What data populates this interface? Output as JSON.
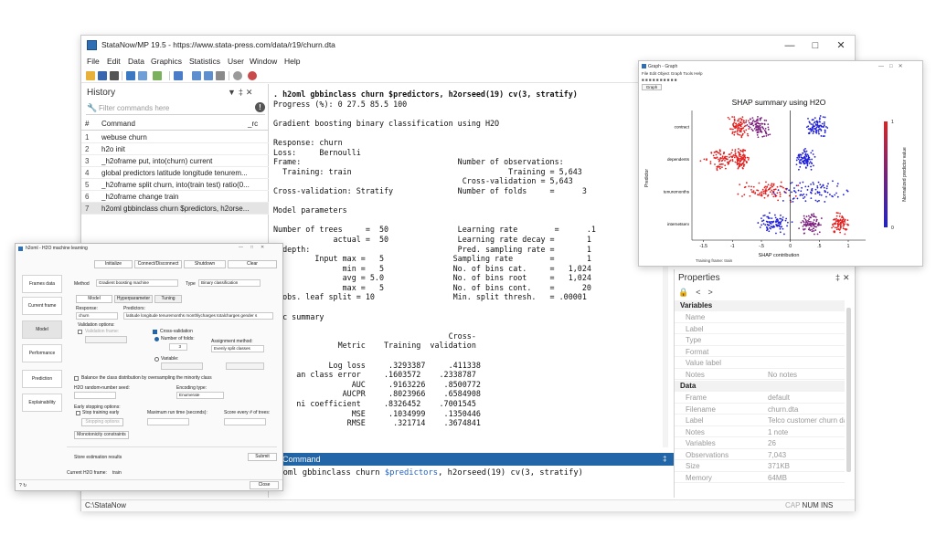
{
  "main": {
    "title": "StataNow/MP 19.5 - https://www.stata-press.com/data/r19/churn.dta",
    "menu": [
      "File",
      "Edit",
      "Data",
      "Graphics",
      "Statistics",
      "User",
      "Window",
      "Help"
    ]
  },
  "history": {
    "title": "History",
    "filter_placeholder": "Filter commands here",
    "col_num": "#",
    "col_command": "Command",
    "col_rc": "_rc",
    "rows": [
      {
        "n": "1",
        "cmd": "webuse churn"
      },
      {
        "n": "2",
        "cmd": "h2o init"
      },
      {
        "n": "3",
        "cmd": "_h2oframe put, into(churn) current"
      },
      {
        "n": "4",
        "cmd": "global predictors latitude longitude tenurem..."
      },
      {
        "n": "5",
        "cmd": "_h2oframe split churn, into(train test) ratio(0..."
      },
      {
        "n": "6",
        "cmd": "_h2oframe change train"
      },
      {
        "n": "7",
        "cmd": "h2oml gbbinclass churn $predictors, h2orse..."
      }
    ]
  },
  "results": {
    "command_line": ". h2oml gbbinclass churn $predictors, h2orseed(19) cv(3, stratify)",
    "body": "\nProgress (%): 0 27.5 85.5 100\n\nGradient boosting binary classification using H2O\n\nResponse: churn\nLoss:     Bernoulli\nFrame:                                  Number of observations:\n  Training: train                                  Training = 5,643\n                                         Cross-validation = 5,643\nCross-validation: Stratify              Number of folds     =      3\n\nModel parameters\n\nNumber of trees     =  50               Learning rate        =      .1\n             actual =  50               Learning rate decay =       1\ne depth:                                Pred. sampling rate =       1\n         Input max =   5               Sampling rate        =       1\n               min =   5               No. of bins cat.     =   1,024\n               avg = 5.0               No. of bins root     =   1,024\n               max =   5               No. of bins cont.    =      20\n. obs. leaf split = 10                 Min. split thresh.   = .00001\n\nric summary\n\n                                      Cross-\n              Metric    Training  validation\n\n            Log loss     .3293387     .411338\n     an class error     .1603572    .2338787\n                 AUC     .9163226    .8500772\n               AUCPR     .8023966    .6584908\n     ni coefficient     .8326452    .7001545\n                 MSE     .1034999    .1350446\n                RMSE      .321714    .3674841"
  },
  "command": {
    "label": "Command",
    "input_prefix": "h2oml gbbinclass churn ",
    "input_global": "$predictors",
    "input_suffix": ", h2orseed(19) cv(3, stratify)"
  },
  "status": {
    "path": "C:\\StataNow",
    "cap": "CAP",
    "num": "NUM",
    "ins": "INS"
  },
  "properties": {
    "title": "Properties",
    "variables_header": "Variables",
    "variables": [
      {
        "k": "Name",
        "v": ""
      },
      {
        "k": "Label",
        "v": ""
      },
      {
        "k": "Type",
        "v": ""
      },
      {
        "k": "Format",
        "v": ""
      },
      {
        "k": "Value label",
        "v": ""
      },
      {
        "k": "Notes",
        "v": "No notes"
      }
    ],
    "data_header": "Data",
    "data": [
      {
        "k": "Frame",
        "v": "default"
      },
      {
        "k": "Filename",
        "v": "churn.dta"
      },
      {
        "k": "Label",
        "v": "Telco customer churn dat"
      },
      {
        "k": "Notes",
        "v": "1 note"
      },
      {
        "k": "Variables",
        "v": "26"
      },
      {
        "k": "Observations",
        "v": "7,043"
      },
      {
        "k": "Size",
        "v": "371KB"
      },
      {
        "k": "Memory",
        "v": "64MB"
      }
    ]
  },
  "graph": {
    "window_title": "Graph - Graph",
    "menu": "File  Edit  Object  Graph  Tools  Help",
    "tab": "Graph",
    "chart_data": {
      "type": "scatter",
      "title": "SHAP summary using H2O",
      "xlabel": "SHAP contribution",
      "ylabel": "Predictor",
      "colorbar_label": "Normalized predictor value",
      "colorbar_ticks": [
        "1",
        "0"
      ],
      "categories": [
        "contract",
        "dependents",
        "tenuremonths",
        "internetserv"
      ],
      "x_ticks": [
        "-1.5",
        "-1",
        "-.5",
        "0",
        ".5",
        "1"
      ],
      "xlim": [
        -1.7,
        1.3
      ],
      "note": "Training frame: train",
      "clusters": [
        {
          "predictor": "contract",
          "x_center": -0.9,
          "spread": 0.1,
          "color": "#e32020"
        },
        {
          "predictor": "contract",
          "x_center": -0.55,
          "spread": 0.12,
          "color": "#7a1f7d"
        },
        {
          "predictor": "contract",
          "x_center": 0.45,
          "spread": 0.12,
          "color": "#2020d8"
        },
        {
          "predictor": "dependents",
          "x_center": -1.2,
          "spread": 0.2,
          "color": "#e32020"
        },
        {
          "predictor": "dependents",
          "x_center": -0.85,
          "spread": 0.1,
          "color": "#e32020"
        },
        {
          "predictor": "dependents",
          "x_center": 0.25,
          "spread": 0.1,
          "color": "#2020d8"
        },
        {
          "predictor": "tenuremonths",
          "x_center": -0.4,
          "spread": 0.28,
          "color": "#e32020"
        },
        {
          "predictor": "tenuremonths",
          "x_center": 0.35,
          "spread": 0.4,
          "color": "#2020d8"
        },
        {
          "predictor": "internetserv",
          "x_center": -0.3,
          "spread": 0.18,
          "color": "#2020d8"
        },
        {
          "predictor": "internetserv",
          "x_center": 0.35,
          "spread": 0.12,
          "color": "#7a1f7d"
        },
        {
          "predictor": "internetserv",
          "x_center": 0.85,
          "spread": 0.1,
          "color": "#e32020"
        }
      ]
    }
  },
  "dialog": {
    "title": "h2oml - H2O machine learning",
    "top_buttons": [
      "Initialize",
      "Connect/Disconnect",
      "Shutdown",
      "Clear"
    ],
    "sidebar": [
      "Frames data",
      "Current frame",
      "Model",
      "Performance",
      "Prediction",
      "Explainability"
    ],
    "method_label": "Method",
    "method_value": "Gradient boosting machine",
    "type_label": "Type",
    "type_value": "Binary classification",
    "tabs": [
      "Model",
      "Hyperparameter",
      "Tuning"
    ],
    "response_label": "Response:",
    "response_value": "churn",
    "predictors_label": "Predictors:",
    "predictors_value": "latitude longitude tenuremonths monthlycharges totalcharges gender s",
    "validation_label": "Validation options:",
    "validation_frame": "Validation frame:",
    "cross_validation": "Cross-validation",
    "number_of_folds": "Number of folds:",
    "folds_value": "3",
    "assignment_method": "Assignment method:",
    "assignment_value": "Evenly split classes",
    "variable_label": "Variable:",
    "balance_label": "Balance the class distribution by oversampling the minority class",
    "seed_label": "H2O random-number seed:",
    "encoding_label": "Encoding type:",
    "encoding_value": "Enumerate",
    "early_label": "Early stopping options:",
    "stop_early": "Stop training early",
    "stopping_options": "Stopping options",
    "max_runtime": "Maximum run time (seconds):",
    "score_every": "Score every # of trees:",
    "monotonicity": "Monotonicity constraints",
    "store_results": "Store estimation results",
    "submit": "Submit",
    "current_frame_label": "Current H2O frame:",
    "current_frame_value": "train",
    "close": "Close"
  }
}
